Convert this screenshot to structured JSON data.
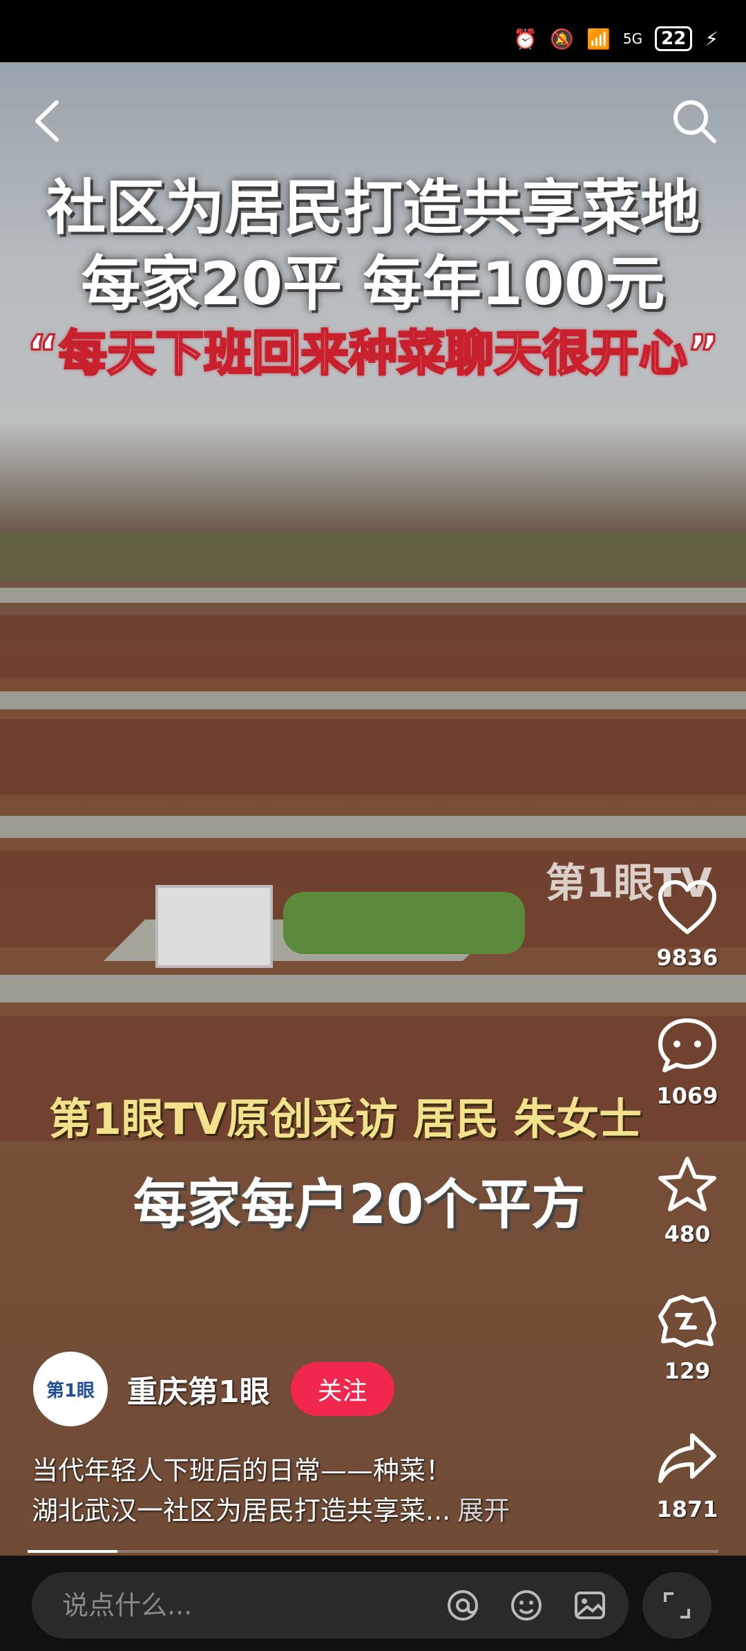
{
  "status_bar": {
    "left_text": "",
    "network": "5G",
    "battery": "22"
  },
  "video": {
    "title_line1": "社区为居民打造共享菜地",
    "title_line2": "每家20平 每年100元",
    "title_line3": "“每天下班回来种菜聊天很开心”",
    "watermark": "第1眼TV",
    "caption_yellow": "第1眼TV原创采访 居民 朱女士",
    "caption_white": "每家每户20个平方",
    "progress_fraction": 0.13
  },
  "actions": {
    "like_count": "9836",
    "comment_count": "1069",
    "favorite_count": "480",
    "share_friends_count": "129",
    "share_count": "1871"
  },
  "author": {
    "avatar_text": "第1眼",
    "name": "重庆第1眼",
    "follow_label": "关注"
  },
  "description": {
    "line1": "当代年轻人下班后的日常——种菜！",
    "line2": "湖北武汉一社区为居民打造共享菜...",
    "expand_label": "展开"
  },
  "comment_bar": {
    "placeholder": "说点什么..."
  },
  "colors": {
    "follow_button": "#f2274d",
    "title_stroke": "#c8202c",
    "caption_yellow": "#f2e28c"
  },
  "icons": [
    "back-icon",
    "search-icon",
    "heart-icon",
    "comment-icon",
    "star-icon",
    "share-friends-icon",
    "share-icon",
    "mention-icon",
    "emoji-icon",
    "image-icon",
    "expand-icon"
  ]
}
